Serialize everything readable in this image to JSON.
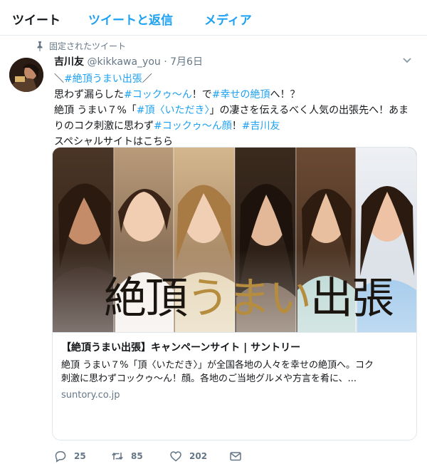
{
  "tabs": [
    {
      "label": "ツイート",
      "active": true
    },
    {
      "label": "ツイートと返信",
      "active": false
    },
    {
      "label": "メディア",
      "active": false
    }
  ],
  "tweet": {
    "pinned_label": "固定されたツイート",
    "name": "吉川友",
    "handle": "@kikkawa_you",
    "separator": "·",
    "date": "7月6日",
    "lines": [
      {
        "segments": [
          {
            "text": "＼",
            "tag": false
          },
          {
            "text": "#絶頂うまい出張",
            "tag": true
          },
          {
            "text": "／",
            "tag": false
          }
        ]
      },
      {
        "segments": [
          {
            "text": "思わず漏らした",
            "tag": false
          },
          {
            "text": "#コックゥ〜ん",
            "tag": true
          },
          {
            "text": "！で",
            "tag": false
          },
          {
            "text": "#幸せの絶頂",
            "tag": true
          },
          {
            "text": "へ！？",
            "tag": false
          }
        ]
      },
      {
        "segments": [
          {
            "text": "絶頂 うまい７%「",
            "tag": false
          },
          {
            "text": "#頂〈いただき〉",
            "tag": true
          },
          {
            "text": "」の凄さを伝えるべく人気の出張先へ！あま",
            "tag": false
          }
        ]
      },
      {
        "segments": [
          {
            "text": "りのコク刺激に思わず",
            "tag": false
          },
          {
            "text": "#コックゥ〜ん顔",
            "tag": true
          },
          {
            "text": "！",
            "tag": false
          },
          {
            "text": "#吉川友",
            "tag": true
          }
        ]
      },
      {
        "segments": [
          {
            "text": "スペシャルサイトはこちら",
            "tag": false
          }
        ]
      }
    ]
  },
  "card": {
    "image_text_1": "絶頂",
    "image_text_2": "うまい",
    "image_text_3": "出張",
    "title": "【絶頂うまい出張】キャンペーンサイト | サントリー",
    "desc_line_1": "絶頂 うまい７%「頂〈いただき〉」が全国各地の人々を幸せの絶頂へ。コク",
    "desc_line_2": "刺激に思わずコックゥ〜ん！顔。各地のご当地グルメや方言を肴に、...",
    "domain": "suntory.co.jp"
  },
  "actions": {
    "reply_count": "25",
    "retweet_count": "85",
    "like_count": "202"
  },
  "colors": {
    "accent": "#1da1f2",
    "muted": "#657786",
    "text": "#14171a"
  }
}
